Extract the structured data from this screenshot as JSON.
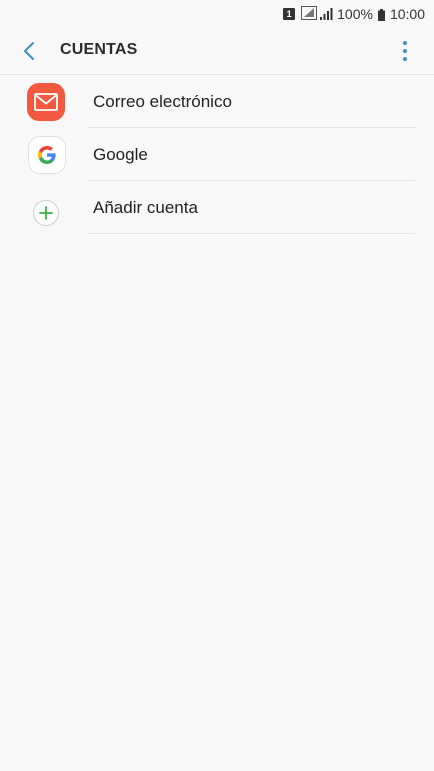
{
  "status_bar": {
    "sim_label": "1",
    "battery_percent": "100%",
    "time": "10:00"
  },
  "header": {
    "title": "CUENTAS",
    "accent_color": "#3f8fbe"
  },
  "accounts": [
    {
      "label": "Correo electrónico",
      "icon": "email-icon",
      "color": "#f2593f"
    },
    {
      "label": "Google",
      "icon": "google-icon"
    },
    {
      "label": "Añadir cuenta",
      "icon": "add-icon",
      "color": "#3dae49"
    }
  ]
}
